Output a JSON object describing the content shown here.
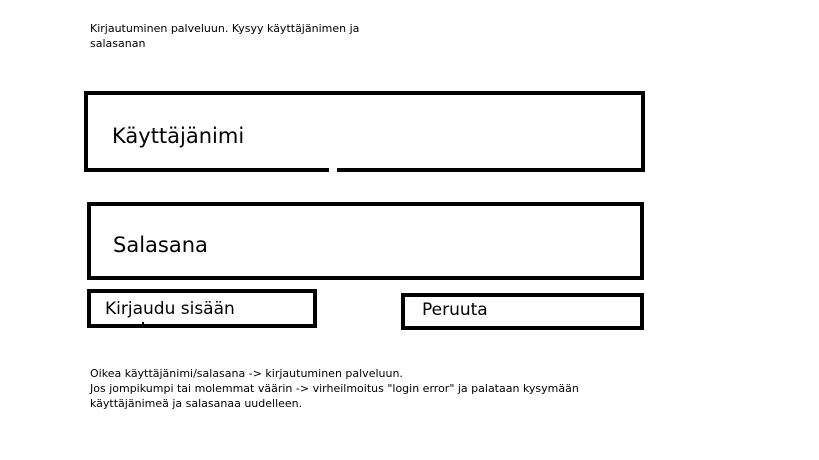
{
  "intro_note": "Kirjautuminen palveluun. Kysyy käyttäjänimen ja\nsalasanan",
  "username_field": {
    "label": "Käyttäjänimi"
  },
  "password_field": {
    "label": "Salasana"
  },
  "buttons": {
    "login_label": "Kirjaudu sisään",
    "cancel_label": "Peruuta"
  },
  "footer_note": "Oikea käyttäjänimi/salasana -> kirjautuminen palveluun.\n Jos jompikumpi tai molemmat väärin -> virheilmoitus \"login error\" ja palataan kysymään\nkäyttäjänimeä ja salasanaa uudelleen.",
  "colors": {
    "border": "#000000",
    "background": "#ffffff",
    "text": "#000000"
  }
}
